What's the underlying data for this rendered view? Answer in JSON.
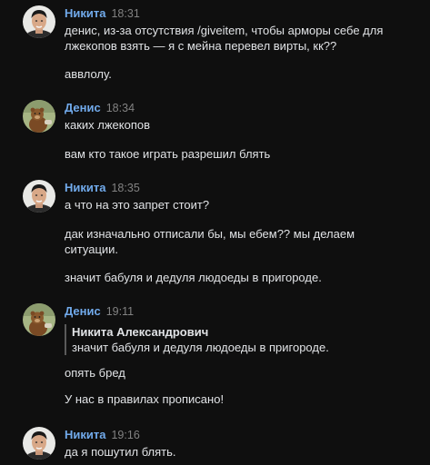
{
  "messages": [
    {
      "author": "Никита",
      "time": "18:31",
      "avatar": "nikita-avatar",
      "texts": [
        "денис, из-за отсутствия /giveitem, чтобы арморы себе для\nлжекопов взять — я с мейна перевел вирты, кк??",
        "аввлолу."
      ]
    },
    {
      "author": "Денис",
      "time": "18:34",
      "avatar": "denis-avatar",
      "texts": [
        "каких лжекопов",
        "вам кто такое играть разрешил блять"
      ]
    },
    {
      "author": "Никита",
      "time": "18:35",
      "avatar": "nikita-avatar",
      "texts": [
        "а что на это запрет стоит?",
        "дак изначально отписали бы, мы ебем?? мы делаем\nситуации.",
        "значит бабуля и дедуля людоеды в пригороде."
      ]
    },
    {
      "author": "Денис",
      "time": "19:11",
      "avatar": "denis-avatar",
      "reply": {
        "author": "Никита Александрович",
        "text": "значит бабуля и дедуля людоеды в пригороде."
      },
      "texts": [
        "опять бред",
        "У нас в правилах прописано!"
      ]
    },
    {
      "author": "Никита",
      "time": "19:16",
      "avatar": "nikita-avatar",
      "texts": [
        "да я пошутил блять."
      ]
    }
  ],
  "colors": {
    "background": "#0f0f0f",
    "author": "#71aaeb",
    "time": "#828282",
    "text": "#e1e3e6"
  }
}
